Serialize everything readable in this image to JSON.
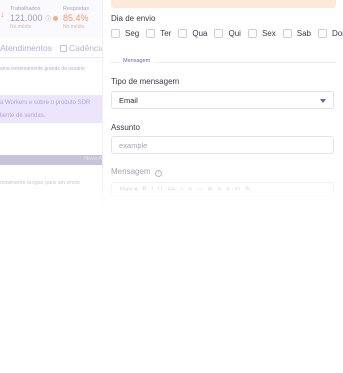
{
  "background": {
    "stats": [
      {
        "label": "Trabalhados",
        "value": "121.000",
        "sub": "No médio"
      },
      {
        "label": "Respostas",
        "value": "85.4%",
        "sub": "No médio"
      }
    ],
    "tabs": [
      "Atendimentos",
      "Cadência"
    ],
    "note": "ama extremamente grande de usuário",
    "banner_lines": [
      "a Workers e sobre o produto SDR",
      "liente de vendas."
    ],
    "bar_button": "Nova A",
    "hint": "ostamente longas para um envio"
  },
  "form": {
    "dias_label": "Dia de envio",
    "days": [
      "Seg",
      "Ter",
      "Qua",
      "Qui",
      "Sex",
      "Sab",
      "Dom"
    ],
    "section_divider": "Mensagem",
    "tipo_label": "Tipo de mensagem",
    "tipo_value": "Email",
    "assunto_label": "Assunto",
    "assunto_placeholder": "example",
    "mensagem_label": "Mensagem",
    "toolbar": [
      "Mais ▾",
      "B",
      "I",
      "U",
      "Aa",
      "⌂",
      "≡",
      "▭",
      "≣",
      "≡",
      "≡",
      "⟲",
      "⟳"
    ]
  },
  "colors": {
    "accent": "#6f5ccc",
    "alert": "#fde9d9",
    "banner": "#ebe6fb"
  }
}
